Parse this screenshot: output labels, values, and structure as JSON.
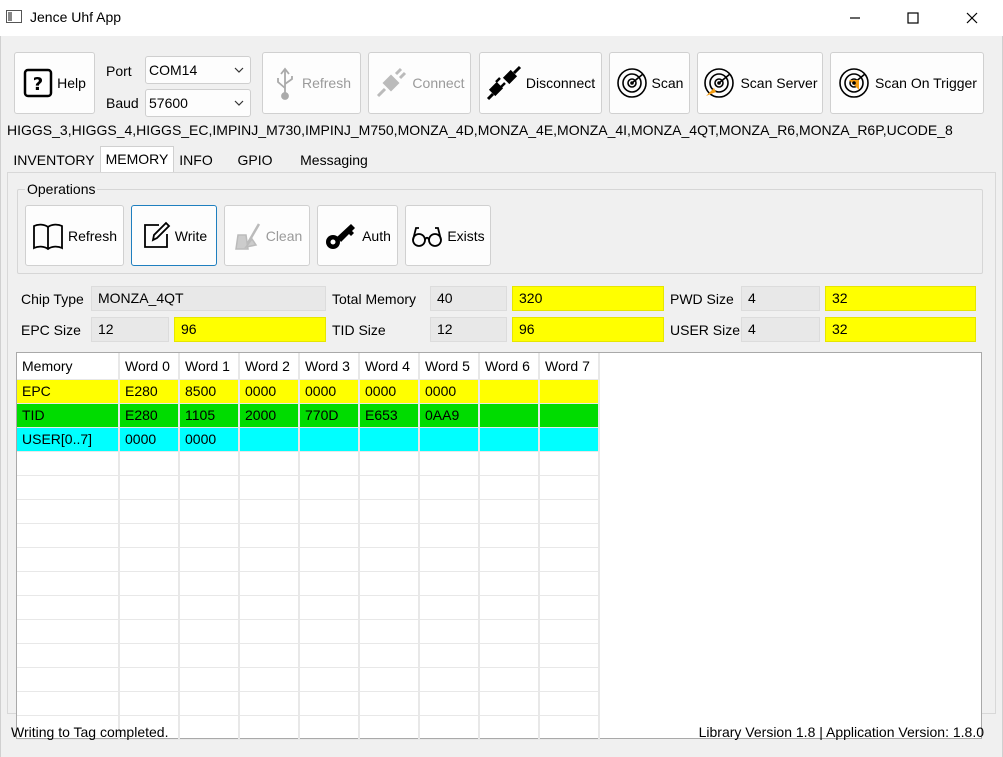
{
  "window": {
    "title": "Jence Uhf App"
  },
  "toolbar": {
    "help": "Help",
    "port_label": "Port",
    "port_value": "COM14",
    "baud_label": "Baud",
    "baud_value": "57600",
    "refresh": "Refresh",
    "connect": "Connect",
    "disconnect": "Disconnect",
    "scan": "Scan",
    "scan_server": "Scan Server",
    "scan_on_trigger": "Scan On Trigger"
  },
  "supported_chips": "HIGGS_3,HIGGS_4,HIGGS_EC,IMPINJ_M730,IMPINJ_M750,MONZA_4D,MONZA_4E,MONZA_4I,MONZA_4QT,MONZA_R6,MONZA_R6P,UCODE_8",
  "tabs": [
    "INVENTORY",
    "MEMORY",
    "INFO",
    "GPIO",
    "Messaging"
  ],
  "active_tab": "MEMORY",
  "operations": {
    "title": "Operations",
    "refresh": "Refresh",
    "write": "Write",
    "clean": "Clean",
    "auth": "Auth",
    "exists": "Exists"
  },
  "info": {
    "chip_type_label": "Chip Type",
    "chip_type": "MONZA_4QT",
    "total_memory_label": "Total Memory",
    "total_memory_words": "40",
    "total_memory_bits": "320",
    "pwd_size_label": "PWD Size",
    "pwd_size_words": "4",
    "pwd_size_bits": "32",
    "epc_size_label": "EPC Size",
    "epc_size_words": "12",
    "epc_size_bits": "96",
    "tid_size_label": "TID Size",
    "tid_size_words": "12",
    "tid_size_bits": "96",
    "user_size_label": "USER Size",
    "user_size_words": "4",
    "user_size_bits": "32"
  },
  "memory_table": {
    "headers": [
      "Memory",
      "Word 0",
      "Word 1",
      "Word 2",
      "Word 3",
      "Word 4",
      "Word 5",
      "Word 6",
      "Word 7"
    ],
    "rows": [
      {
        "color": "#ffff00",
        "cells": [
          "EPC",
          "E280",
          "8500",
          "0000",
          "0000",
          "0000",
          "0000",
          "",
          ""
        ]
      },
      {
        "color": "#00dc00",
        "cells": [
          "TID",
          "E280",
          "1105",
          "2000",
          "770D",
          "E653",
          "0AA9",
          "",
          ""
        ]
      },
      {
        "color": "#00ffff",
        "cells": [
          "USER[0..7]",
          "0000",
          "0000",
          "",
          "",
          "",
          "",
          "",
          ""
        ]
      }
    ]
  },
  "status": {
    "message": "Writing to Tag completed.",
    "versions": "Library Version 1.8 | Application Version: 1.8.0"
  }
}
